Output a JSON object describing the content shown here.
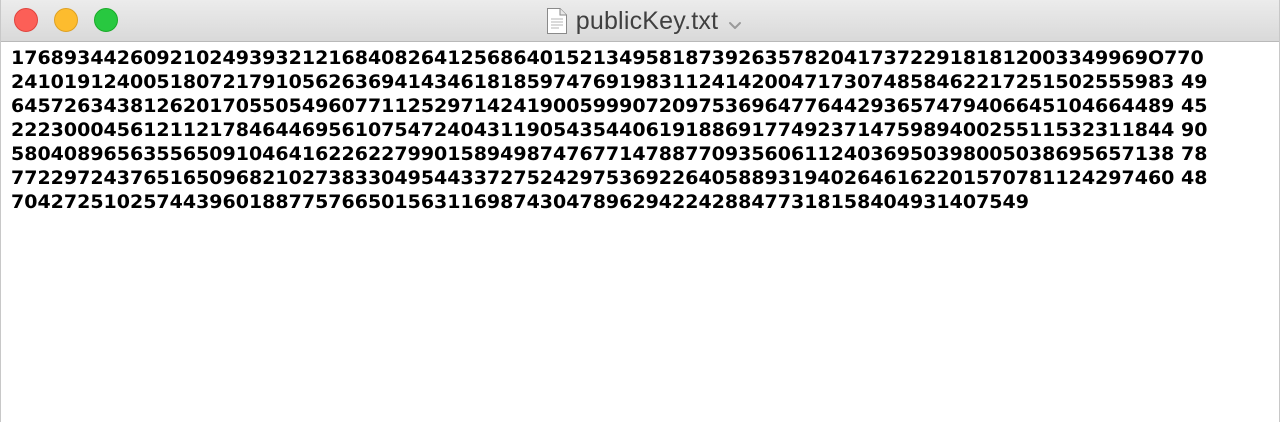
{
  "window": {
    "title": "publicKey.txt",
    "file_icon": "document-icon",
    "title_menu_icon": "chevron-down-icon"
  },
  "controls": {
    "close_color": "#fc5f57",
    "minimize_color": "#fdbc2e",
    "zoom_color": "#28c840"
  },
  "document": {
    "lines": [
      "17689344260921024939321216840826412568640152134958187392635782041737229181812003349969O770",
      "2410191240051807217910562636941434618185974769198311241420047173074858462217251502555983 49",
      "6457263438126201705505496077112529714241900599907209753696477644293657479406645104664489 45",
      "2223000456121121784644695610754724043119054354406191886917749237147598940025511532311844 90",
      "5804089656355650910464162262279901589498747677147887709356061124036950398005038695657138 78",
      "7722972437651650968210273833049544337275242975369226405889319402646162201570781124297460 48",
      "70427251025744396018877576650156311698743047896294224288477318158404931407549"
    ]
  }
}
